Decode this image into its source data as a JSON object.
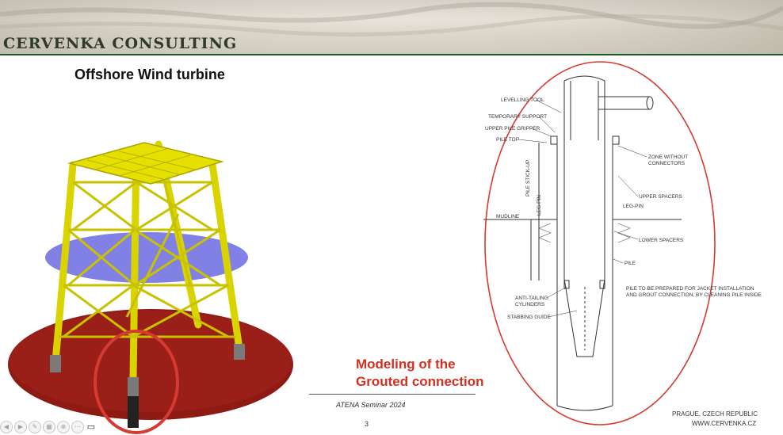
{
  "header": {
    "brand": "CERVENKA CONSULTING",
    "rule_color": "#1f5a25"
  },
  "slide": {
    "title": "Offshore Wind turbine",
    "caption": "Modeling of the\nGrouted connection",
    "caption_color": "#d33021",
    "highlight_color": "#d63a33",
    "footer": {
      "seminar": "ATENA Seminar 2024",
      "page": "3",
      "location": "PRAGUE, CZECH REPUBLIC",
      "website": "WWW.CERVENKA.CZ"
    }
  },
  "drawing": {
    "labels": {
      "levelling_tool": "LEVELLING TOOL",
      "temporary_support": "TEMPORARY SUPPORT",
      "upper_pile_gripper": "UPPER PILE GRIPPER",
      "pile_top": "PILE TOP",
      "zone_without_connectors": "ZONE WITHOUT\nCONNECTORS",
      "pile_stick_up": "PILE STICK-UP",
      "leg_pin_vertical": "LEG-PIN",
      "upper_spacers": "UPPER SPACERS",
      "leg_pin": "LEG-PIN",
      "mudline": "MUDLINE",
      "lower_spacers": "LOWER SPACERS",
      "pile": "PILE",
      "pile_prepared": "PILE TO BE PREPARED FOR JACKET INSTALLATION\nAND GROUT CONNECTION, BY CLEANING PILE INSIDE",
      "anti_tailing": "ANTI-TAILING\nCYLINDERS",
      "stabbing_guide": "STABBING GUIDE"
    }
  },
  "player": {
    "icons": [
      "prev-icon",
      "next-icon",
      "pen-icon",
      "slides-icon",
      "zoom-icon",
      "more-icon",
      "camera-icon"
    ]
  }
}
